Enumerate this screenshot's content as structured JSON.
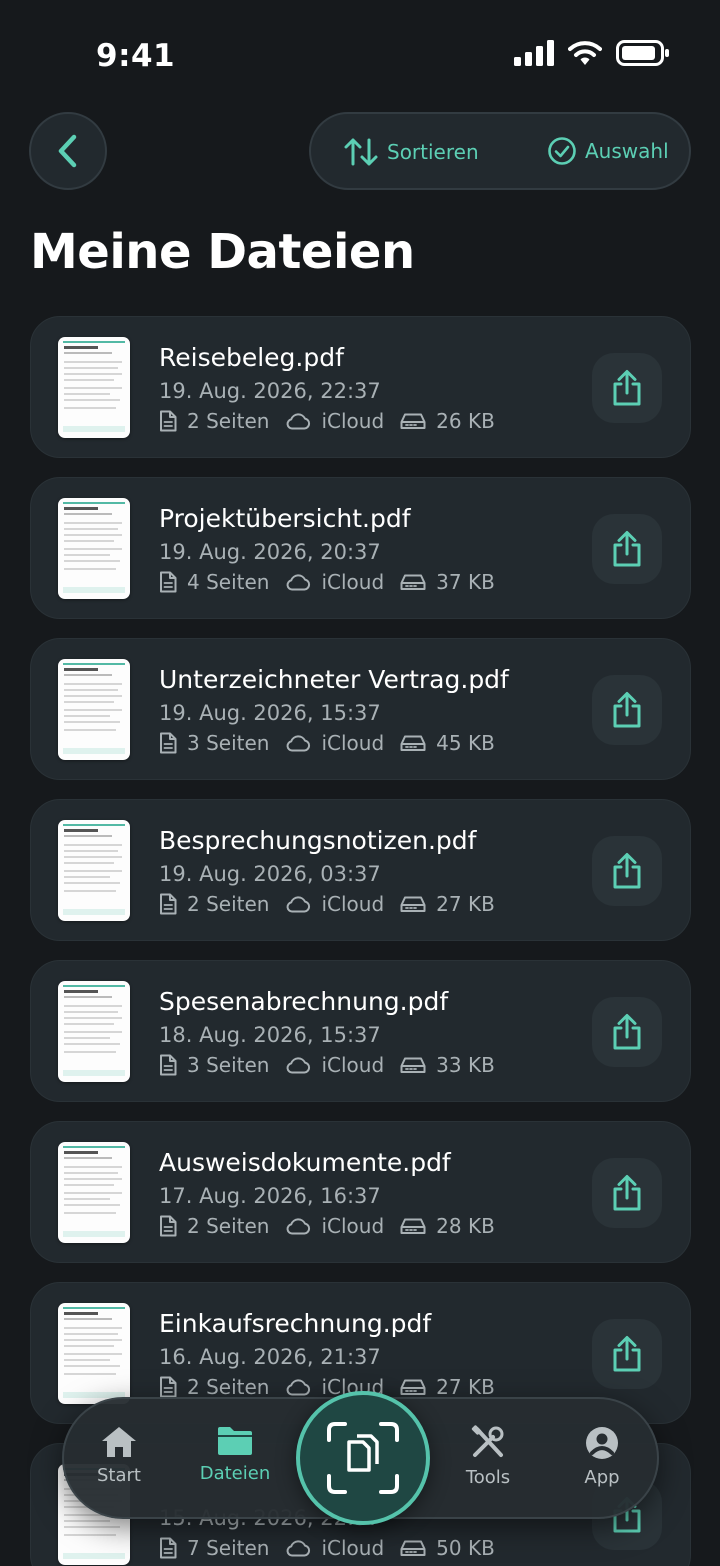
{
  "status": {
    "time": "9:41"
  },
  "header": {
    "sort_label": "Sortieren",
    "select_label": "Auswahl",
    "title": "Meine Dateien"
  },
  "colors": {
    "accent": "#5ccfb4",
    "background": "#16191c",
    "card": "#22292e"
  },
  "files": [
    {
      "name": "Reisebeleg.pdf",
      "date": "19. Aug. 2026, 22:37",
      "pages": "2 Seiten",
      "storage": "iCloud",
      "size": "26 KB"
    },
    {
      "name": "Projektübersicht.pdf",
      "date": "19. Aug. 2026, 20:37",
      "pages": "4 Seiten",
      "storage": "iCloud",
      "size": "37 KB"
    },
    {
      "name": "Unterzeichneter Vertrag.pdf",
      "date": "19. Aug. 2026, 15:37",
      "pages": "3 Seiten",
      "storage": "iCloud",
      "size": "45 KB"
    },
    {
      "name": "Besprechungsnotizen.pdf",
      "date": "19. Aug. 2026, 03:37",
      "pages": "2 Seiten",
      "storage": "iCloud",
      "size": "27 KB"
    },
    {
      "name": "Spesenabrechnung.pdf",
      "date": "18. Aug. 2026, 15:37",
      "pages": "3 Seiten",
      "storage": "iCloud",
      "size": "33 KB"
    },
    {
      "name": "Ausweisdokumente.pdf",
      "date": "17. Aug. 2026, 16:37",
      "pages": "2 Seiten",
      "storage": "iCloud",
      "size": "28 KB"
    },
    {
      "name": "Einkaufsrechnung.pdf",
      "date": "16. Aug. 2026, 21:37",
      "pages": "2 Seiten",
      "storage": "iCloud",
      "size": "27 KB"
    },
    {
      "name": "",
      "date": "15. Aug. 2026, 22:37",
      "pages": "7 Seiten",
      "storage": "iCloud",
      "size": "50 KB"
    }
  ],
  "nav": {
    "start": "Start",
    "files": "Dateien",
    "tools": "Tools",
    "app": "App",
    "icons": [
      "home-icon",
      "folder-icon",
      "scan-icon",
      "tools-icon",
      "account-icon"
    ]
  }
}
